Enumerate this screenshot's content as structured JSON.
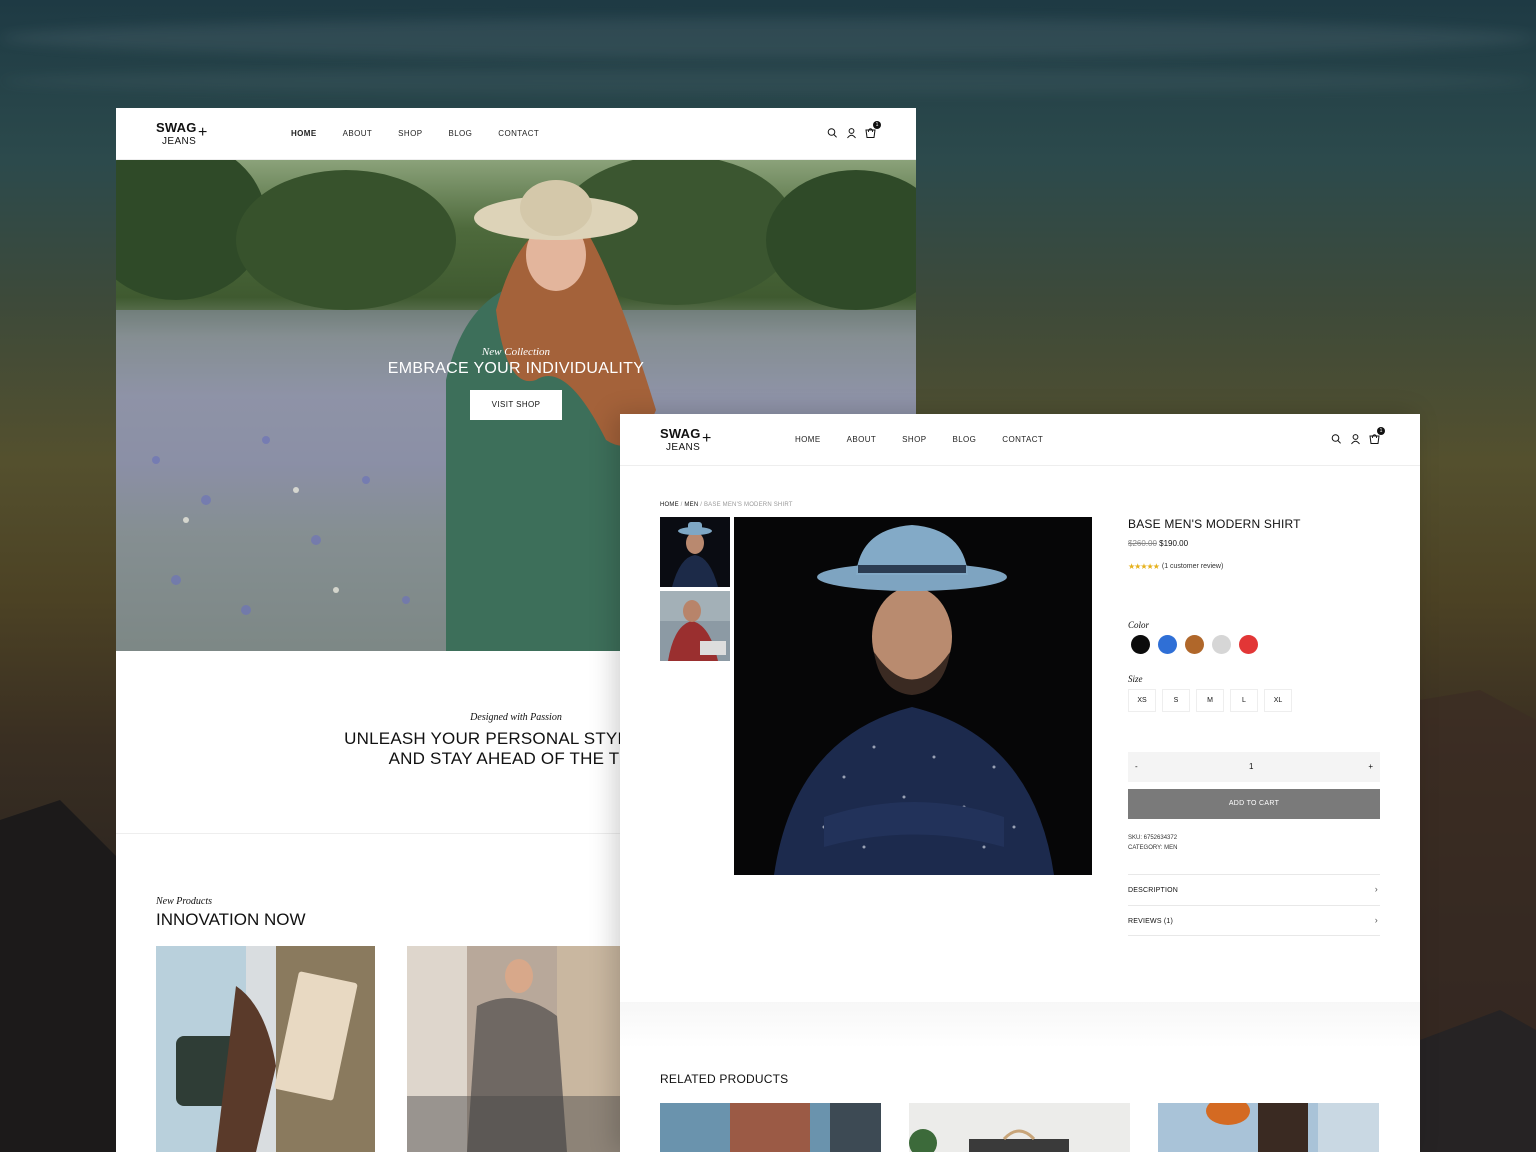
{
  "brand": {
    "line1": "SWAG",
    "line2": "JEANS",
    "mark": "+"
  },
  "nav": {
    "home": "HOME",
    "about": "ABOUT",
    "shop": "SHOP",
    "blog": "BLOG",
    "contact": "CONTACT"
  },
  "cart_count": "1",
  "home": {
    "hero": {
      "kicker": "New Collection",
      "title": "EMBRACE YOUR INDIVIDUALITY",
      "button": "VISIT SHOP"
    },
    "passion": {
      "kicker": "Designed with Passion",
      "line1": "UNLEASH YOUR PERSONAL STYLE WITH",
      "line2": "AND STAY AHEAD OF THE TRE"
    },
    "new_products": {
      "kicker": "New Products",
      "title": "INNOVATION NOW"
    }
  },
  "product": {
    "breadcrumb": {
      "home": "HOME",
      "sep": " / ",
      "category": "MEN",
      "current": "BASE MEN'S MODERN SHIRT"
    },
    "title": "BASE MEN'S MODERN SHIRT",
    "price_old": "$260.00",
    "price_new": "$190.00",
    "stars": "★★★★★",
    "reviews_text": "(1 customer review)",
    "color_label": "Color",
    "colors": [
      "#0b0b0b",
      "#2f6fd6",
      "#b0672a",
      "#d6d6d6",
      "#e23636"
    ],
    "size_label": "Size",
    "sizes": [
      "XS",
      "S",
      "M",
      "L",
      "XL"
    ],
    "qty_minus": "-",
    "qty_value": "1",
    "qty_plus": "+",
    "add_to_cart": "ADD TO CART",
    "sku": "SKU: 6752634372",
    "category": "CATEGORY: MEN",
    "description": "DESCRIPTION",
    "reviews": "REVIEWS (1)",
    "chevron": "›"
  },
  "related": {
    "title": "RELATED PRODUCTS"
  }
}
